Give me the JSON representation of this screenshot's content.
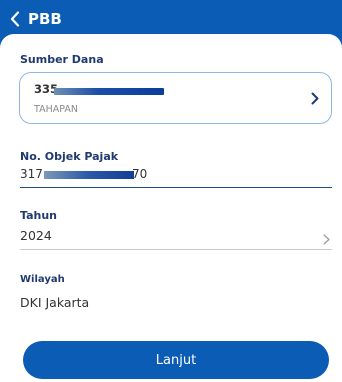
{
  "header": {
    "title": "PBB",
    "back_icon": "chevron-left-icon"
  },
  "source": {
    "label": "Sumber Dana",
    "account_number_visible_prefix": "335",
    "account_type": "TAHAPAN",
    "chevron_icon": "chevron-right-icon"
  },
  "tax_object": {
    "label": "No. Objek Pajak",
    "value_visible_prefix": "317",
    "value_visible_suffix": "70"
  },
  "year": {
    "label": "Tahun",
    "value": "2024",
    "chevron_icon": "chevron-right-icon"
  },
  "region": {
    "label": "Wilayah",
    "value": "DKI Jakarta"
  },
  "actions": {
    "submit_label": "Lanjut"
  },
  "colors": {
    "brand_blue": "#0b5cb5",
    "label_navy": "#1f3a70",
    "card_border": "#8fb8e3"
  }
}
